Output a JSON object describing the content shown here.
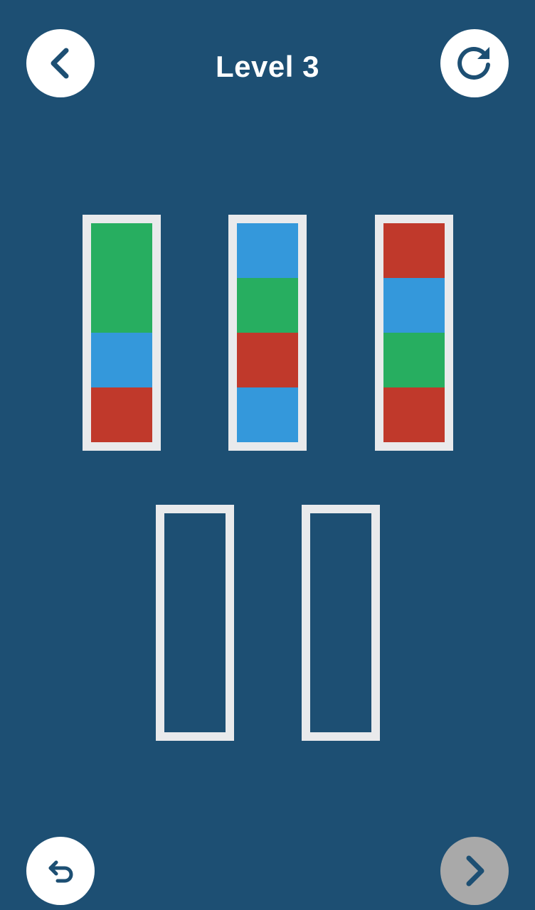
{
  "header": {
    "title": "Level 3"
  },
  "buttons": {
    "back": {
      "icon": "chevron-left-icon"
    },
    "restart": {
      "icon": "restart-icon"
    },
    "undo": {
      "icon": "undo-icon"
    },
    "next": {
      "icon": "chevron-right-icon",
      "disabled": true
    }
  },
  "colors": {
    "background": "#1d4f73",
    "tube_border": "#e9eaec",
    "green": "#27ae60",
    "blue": "#3498db",
    "red": "#c0392b",
    "button_bg": "#ffffff",
    "button_disabled_bg": "#a9a9a9",
    "icon": "#1d4f73"
  },
  "tube_capacity": 4,
  "tubes": [
    {
      "id": "tube-1",
      "layers_top_to_bottom": [
        "green",
        "green",
        "blue",
        "red"
      ]
    },
    {
      "id": "tube-2",
      "layers_top_to_bottom": [
        "blue",
        "green",
        "red",
        "blue"
      ]
    },
    {
      "id": "tube-3",
      "layers_top_to_bottom": [
        "red",
        "blue",
        "green",
        "red"
      ]
    },
    {
      "id": "tube-4",
      "layers_top_to_bottom": []
    },
    {
      "id": "tube-5",
      "layers_top_to_bottom": []
    }
  ]
}
